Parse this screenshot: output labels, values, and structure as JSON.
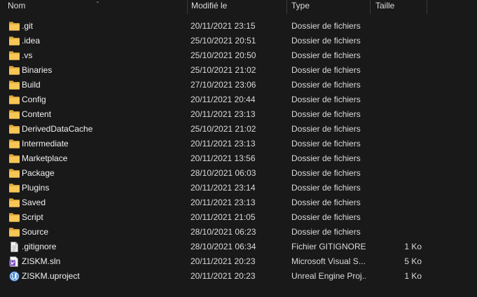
{
  "columns": {
    "name": "Nom",
    "modified": "Modifié le",
    "type": "Type",
    "size": "Taille"
  },
  "files": [
    {
      "name": ".git",
      "modified": "20/11/2021 23:15",
      "type": "Dossier de fichiers",
      "size": "",
      "icon": "folder-icon"
    },
    {
      "name": ".idea",
      "modified": "25/10/2021 20:51",
      "type": "Dossier de fichiers",
      "size": "",
      "icon": "folder-icon"
    },
    {
      "name": ".vs",
      "modified": "25/10/2021 20:50",
      "type": "Dossier de fichiers",
      "size": "",
      "icon": "folder-icon"
    },
    {
      "name": "Binaries",
      "modified": "25/10/2021 21:02",
      "type": "Dossier de fichiers",
      "size": "",
      "icon": "folder-icon"
    },
    {
      "name": "Build",
      "modified": "27/10/2021 23:06",
      "type": "Dossier de fichiers",
      "size": "",
      "icon": "folder-icon"
    },
    {
      "name": "Config",
      "modified": "20/11/2021 20:44",
      "type": "Dossier de fichiers",
      "size": "",
      "icon": "folder-icon"
    },
    {
      "name": "Content",
      "modified": "20/11/2021 23:13",
      "type": "Dossier de fichiers",
      "size": "",
      "icon": "folder-icon"
    },
    {
      "name": "DerivedDataCache",
      "modified": "25/10/2021 21:02",
      "type": "Dossier de fichiers",
      "size": "",
      "icon": "folder-icon"
    },
    {
      "name": "Intermediate",
      "modified": "20/11/2021 23:13",
      "type": "Dossier de fichiers",
      "size": "",
      "icon": "folder-icon"
    },
    {
      "name": "Marketplace",
      "modified": "20/11/2021 13:56",
      "type": "Dossier de fichiers",
      "size": "",
      "icon": "folder-icon"
    },
    {
      "name": "Package",
      "modified": "28/10/2021 06:03",
      "type": "Dossier de fichiers",
      "size": "",
      "icon": "folder-icon"
    },
    {
      "name": "Plugins",
      "modified": "20/11/2021 23:14",
      "type": "Dossier de fichiers",
      "size": "",
      "icon": "folder-icon"
    },
    {
      "name": "Saved",
      "modified": "20/11/2021 23:13",
      "type": "Dossier de fichiers",
      "size": "",
      "icon": "folder-icon"
    },
    {
      "name": "Script",
      "modified": "20/11/2021 21:05",
      "type": "Dossier de fichiers",
      "size": "",
      "icon": "folder-icon"
    },
    {
      "name": "Source",
      "modified": "28/10/2021 06:23",
      "type": "Dossier de fichiers",
      "size": "",
      "icon": "folder-icon"
    },
    {
      "name": ".gitignore",
      "modified": "28/10/2021 06:34",
      "type": "Fichier GITIGNORE",
      "size": "1 Ko",
      "icon": "text-file-icon"
    },
    {
      "name": "ZISKM.sln",
      "modified": "20/11/2021 20:23",
      "type": "Microsoft Visual S...",
      "size": "5 Ko",
      "icon": "visual-studio-solution-icon"
    },
    {
      "name": "ZISKM.uproject",
      "modified": "20/11/2021 20:23",
      "type": "Unreal Engine Proj...",
      "size": "1 Ko",
      "icon": "unreal-engine-icon"
    }
  ],
  "colors": {
    "background": "#191919",
    "folder": "#f2c14e",
    "text": "#f0f0f0"
  }
}
